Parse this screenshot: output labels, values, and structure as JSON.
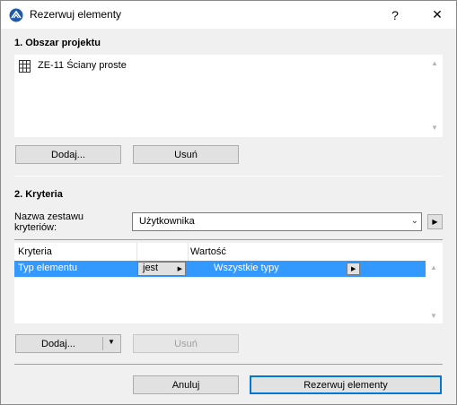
{
  "window": {
    "title": "Rezerwuj elementy",
    "help_label": "?",
    "close_label": "✕"
  },
  "section1": {
    "title": "1. Obszar projektu",
    "items": [
      {
        "label": "ZE-11 Ściany proste",
        "icon": "grid-icon"
      }
    ],
    "add_label": "Dodaj...",
    "remove_label": "Usuń"
  },
  "section2": {
    "title": "2. Kryteria",
    "set_label": "Nazwa zestawu kryteriów:",
    "set_value": "Użytkownika",
    "columns": [
      "Kryteria",
      "",
      "Wartość"
    ],
    "rows": [
      {
        "criterion": "Typ elementu",
        "operator": "jest",
        "value": "Wszystkie typy"
      }
    ],
    "add_label": "Dodaj...",
    "remove_label": "Usuń"
  },
  "footer": {
    "cancel_label": "Anuluj",
    "reserve_label": "Rezerwuj elementy"
  },
  "colors": {
    "selection": "#3399ff",
    "dialog_bg": "#f0f0f0"
  }
}
